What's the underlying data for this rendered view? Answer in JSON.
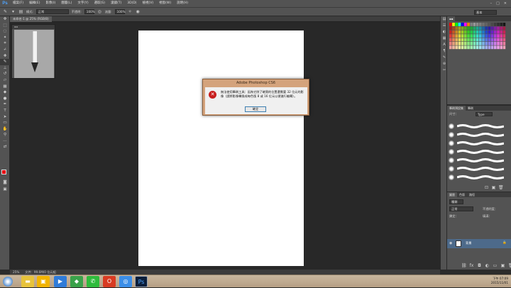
{
  "app": {
    "logo": "Ps"
  },
  "menubar": {
    "items": [
      "檔案(F)",
      "編輯(E)",
      "影像(I)",
      "圖層(L)",
      "文字(Y)",
      "選取(S)",
      "濾鏡(T)",
      "3D(D)",
      "檢視(V)",
      "視窗(W)",
      "說明(H)"
    ],
    "controls": {
      "min": "–",
      "max": "□",
      "close": "✕"
    }
  },
  "options": {
    "mode_label": "模式:",
    "mode_value": "正常",
    "opacity_label": "不透明:",
    "opacity_value": "100%",
    "flow_label": "流量:",
    "flow_value": "100%",
    "workspace": "基本"
  },
  "document": {
    "tab_label": "未命名-1 @ 25% (RGB/8)",
    "zoom": "25%",
    "doc_info": "文件：99.6M/0 位元組"
  },
  "brush_preview": {
    "header": "◂ ▸"
  },
  "dialog": {
    "title": "Adobe Photoshop CS6",
    "message": "無法使用筆刷工具：因為它除了確實的位置還需要 32 位元的影像（請將影像轉換成每色版 8 或 16 位元以便進行編輯）。",
    "ok_label": "確定"
  },
  "brushes_panel": {
    "tabs": [
      "筆刷預設集",
      "筆刷"
    ],
    "size_label": "尺寸：",
    "search_placeholder": "Type"
  },
  "layers_panel": {
    "tabs": [
      "圖層",
      "色版",
      "路徑"
    ],
    "kind_label": "種類",
    "blend_value": "正常",
    "opacity_label": "不透明度：",
    "lock_label": "鎖定：",
    "fill_label": "填滿：",
    "layer_name": "背景"
  },
  "taskbar": {
    "clock_time": "下午 07:09",
    "clock_date": "2015/11/01"
  },
  "colors": {
    "foreground": "#e8000d",
    "background": "#ffffff",
    "dialog_frame": "#d4a37c",
    "layer_selected": "#4d6a8a"
  }
}
